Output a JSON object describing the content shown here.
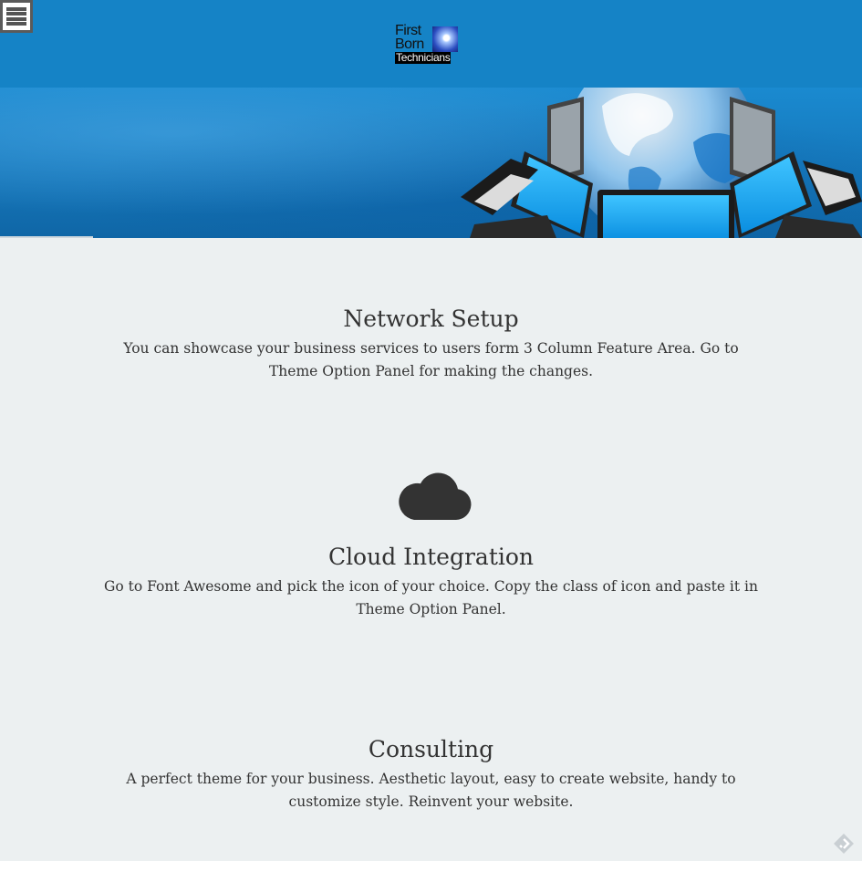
{
  "header": {
    "logo": {
      "line1": "First",
      "line2": "Born",
      "line3": "Technicians"
    },
    "menu_icon": "hamburger-menu-icon",
    "background_color": "#1583c6"
  },
  "banner": {
    "image": "globe-with-laptops-illustration"
  },
  "features": [
    {
      "title": "Network Setup",
      "text": "You can showcase your business services to users form 3 Column Feature Area. Go to Theme Option Panel for making the changes."
    },
    {
      "icon": "cloud-icon",
      "title": "Cloud Integration",
      "text": "Go to Font Awesome and pick the icon of your choice. Copy the class of icon and paste it in Theme Option Panel."
    },
    {
      "title": "Consulting",
      "text": "A perfect theme for your business. Aesthetic layout, easy to create website, handy to customize style. Reinvent your website."
    }
  ],
  "corner_icon": "feedly-icon",
  "colors": {
    "accent": "#1583c6",
    "content_background": "#ecf0f1",
    "text": "#333333"
  }
}
